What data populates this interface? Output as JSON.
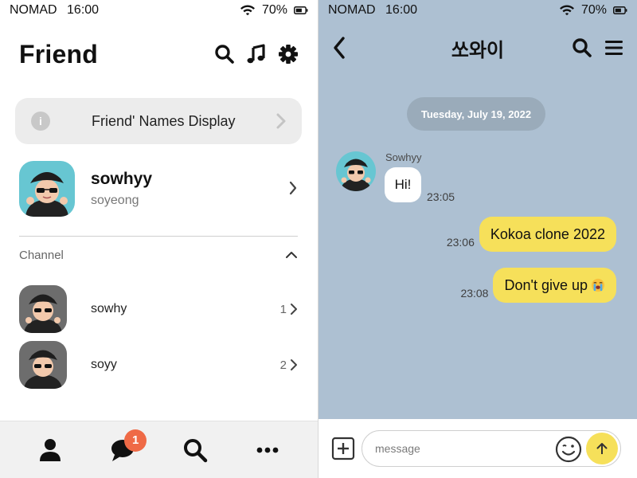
{
  "status": {
    "carrier": "NOMAD",
    "time": "16:00",
    "battery": "70%"
  },
  "friends": {
    "title": "Friend",
    "header_icons": [
      "search-icon",
      "music-icon",
      "gear-icon"
    ],
    "notice": "Friend' Names Display",
    "profile": {
      "name": "sowhyy",
      "subtitle": "soyeong"
    },
    "channel": {
      "label": "Channel",
      "items": [
        {
          "name": "sowhy",
          "count": "1"
        },
        {
          "name": "soyy",
          "count": "2"
        }
      ]
    },
    "tabs": [
      "person-icon",
      "chat-icon",
      "search-icon",
      "more-icon"
    ],
    "chat_badge": "1"
  },
  "chat": {
    "title": "쏘와이",
    "date": "Tuesday, July 19, 2022",
    "messages": [
      {
        "direction": "in",
        "sender": "Sowhyy",
        "text": "Hi!",
        "time": "23:05"
      },
      {
        "direction": "out",
        "text": "Kokoa clone 2022",
        "time": "23:06"
      },
      {
        "direction": "out",
        "text": "Don't give up",
        "emoji": "loudly-crying-face-icon",
        "time": "23:08"
      }
    ],
    "composer": {
      "placeholder": "message"
    }
  },
  "colors": {
    "chat_background": "#adc0d2",
    "outgoing_bubble": "#f6e05a",
    "badge": "#ef6a46",
    "date_pill": "#9aabba"
  }
}
